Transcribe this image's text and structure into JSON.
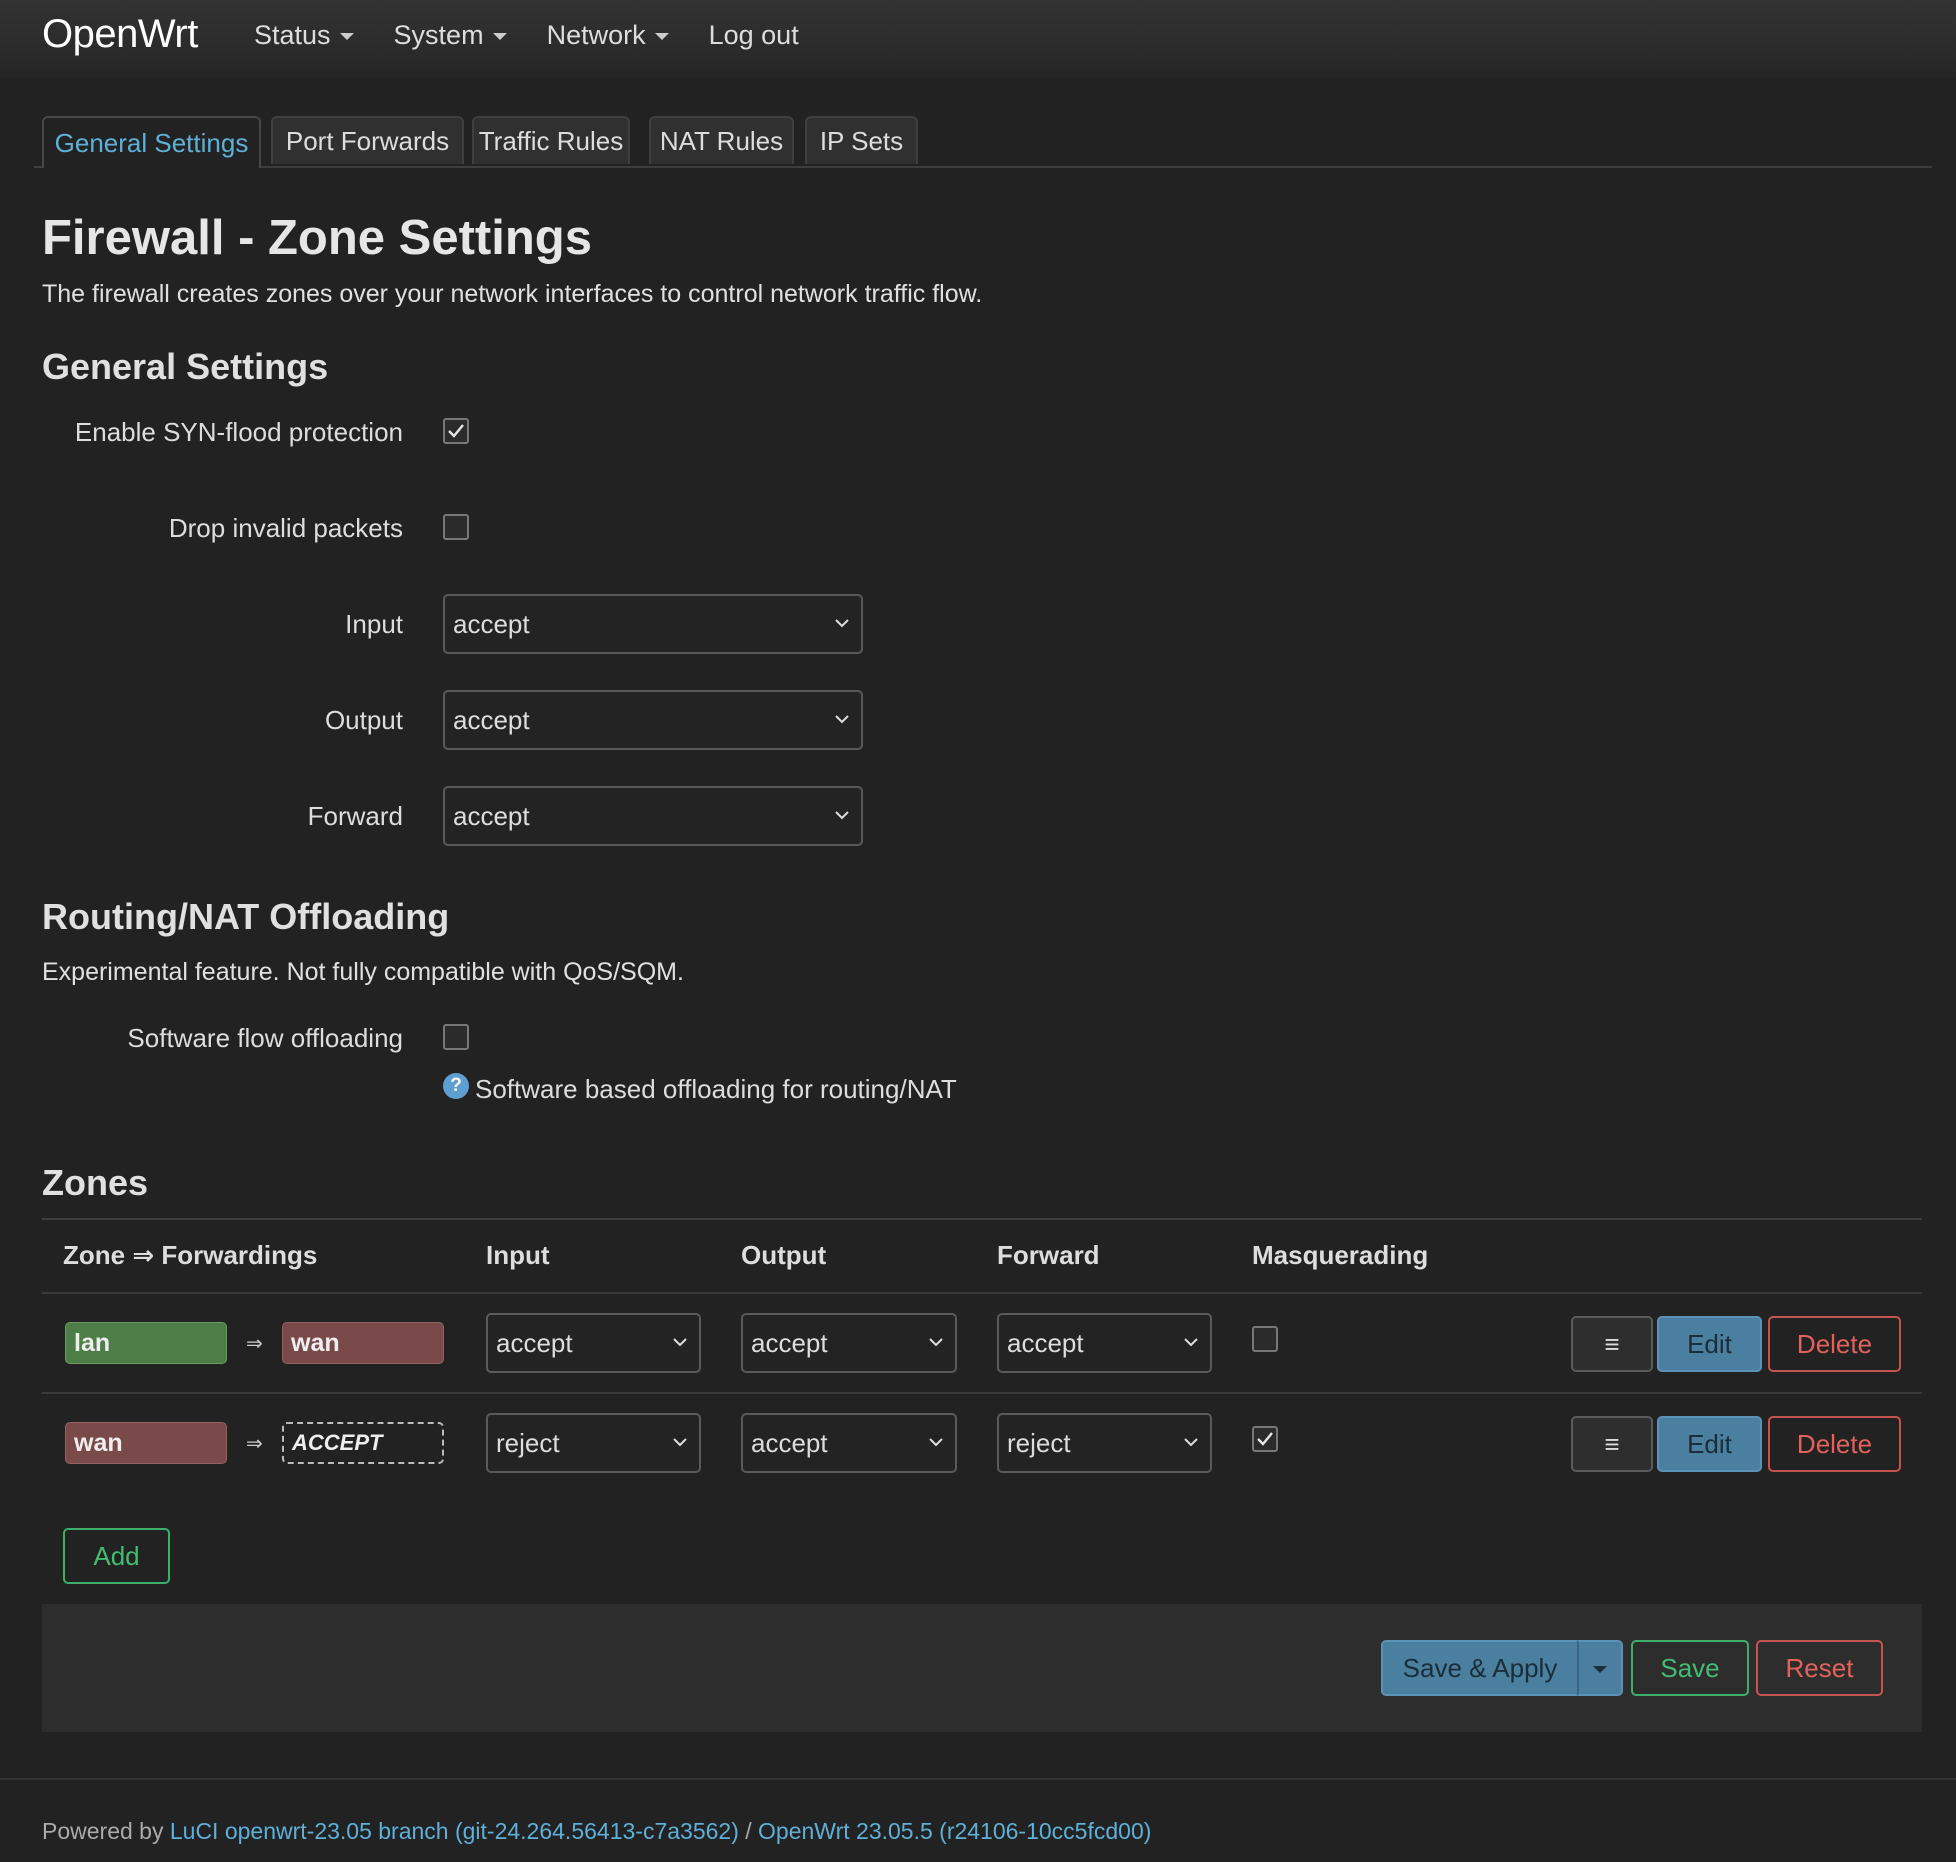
{
  "brand": "OpenWrt",
  "nav": {
    "status": "Status",
    "system": "System",
    "network": "Network",
    "logout": "Log out"
  },
  "tabs": [
    "General Settings",
    "Port Forwards",
    "Traffic Rules",
    "NAT Rules",
    "IP Sets"
  ],
  "page": {
    "title": "Firewall - Zone Settings",
    "description": "The firewall creates zones over your network interfaces to control network traffic flow."
  },
  "general": {
    "heading": "General Settings",
    "syn_flood_label": "Enable SYN-flood protection",
    "drop_invalid_label": "Drop invalid packets",
    "input_label": "Input",
    "input_value": "accept",
    "output_label": "Output",
    "output_value": "accept",
    "forward_label": "Forward",
    "forward_value": "accept"
  },
  "offloading": {
    "heading": "Routing/NAT Offloading",
    "description": "Experimental feature. Not fully compatible with QoS/SQM.",
    "software_label": "Software flow offloading",
    "help_icon": "?",
    "hint": "Software based offloading for routing/NAT"
  },
  "zones": {
    "heading": "Zones",
    "headers": {
      "zone": "Zone ⇒ Forwardings",
      "input": "Input",
      "output": "Output",
      "forward": "Forward",
      "masq": "Masquerading"
    },
    "arrow": "⇒",
    "rows": [
      {
        "zone": "lan",
        "dest": "wan",
        "input": "accept",
        "output": "accept",
        "forward": "accept"
      },
      {
        "zone": "wan",
        "dest": "ACCEPT",
        "input": "reject",
        "output": "accept",
        "forward": "reject"
      }
    ],
    "menu_label": "≡",
    "edit_label": "Edit",
    "delete_label": "Delete",
    "add_label": "Add"
  },
  "actions": {
    "save_apply": "Save & Apply",
    "save": "Save",
    "reset": "Reset"
  },
  "footer": {
    "prefix": "Powered by",
    "luci_link": "LuCI openwrt-23.05 branch (git-24.264.56413-c7a3562)",
    "separator": "/",
    "openwrt_link": "OpenWrt 23.05.5 (r24106-10cc5fcd00)"
  },
  "colors": {
    "accent": "#5eb0d9",
    "lan": "#4e7e47",
    "wan": "#7a4a4a",
    "positive": "#44bb72",
    "negative": "#e0625b"
  },
  "state": {
    "syn_flood_checked": true,
    "drop_invalid_checked": false,
    "software_offloading_checked": false,
    "lan_masquerading_checked": false,
    "wan_masquerading_checked": true
  }
}
